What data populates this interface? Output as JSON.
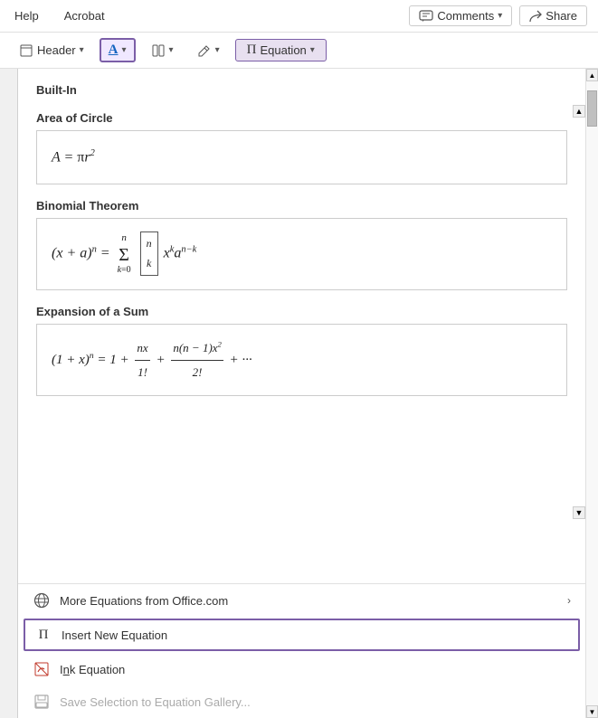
{
  "menubar": {
    "items": [
      {
        "label": "Help"
      },
      {
        "label": "Acrobat"
      }
    ],
    "comments_btn": "Comments",
    "share_btn": "Share"
  },
  "ribbon": {
    "header_label": "Header",
    "equation_label": "Equation"
  },
  "dropdown": {
    "section_title": "Built-In",
    "equations": [
      {
        "name": "Area of Circle",
        "display": "A = πr²"
      },
      {
        "name": "Binomial Theorem",
        "display": "binomial"
      },
      {
        "name": "Expansion of a Sum",
        "display": "expansion"
      }
    ]
  },
  "bottom_menu": {
    "items": [
      {
        "id": "more-equations",
        "label": "More Equations from Office.com",
        "has_arrow": true,
        "disabled": false,
        "active": false
      },
      {
        "id": "insert-new-equation",
        "label": "Insert New Equation",
        "has_arrow": false,
        "disabled": false,
        "active": true
      },
      {
        "id": "ink-equation",
        "label": "Ink Equation",
        "has_arrow": false,
        "disabled": false,
        "active": false
      },
      {
        "id": "save-selection",
        "label": "Save Selection to Equation Gallery...",
        "has_arrow": false,
        "disabled": true,
        "active": false
      }
    ]
  },
  "colors": {
    "accent_purple": "#7B5EA7",
    "border": "#ccc",
    "text_bold": "#333"
  }
}
